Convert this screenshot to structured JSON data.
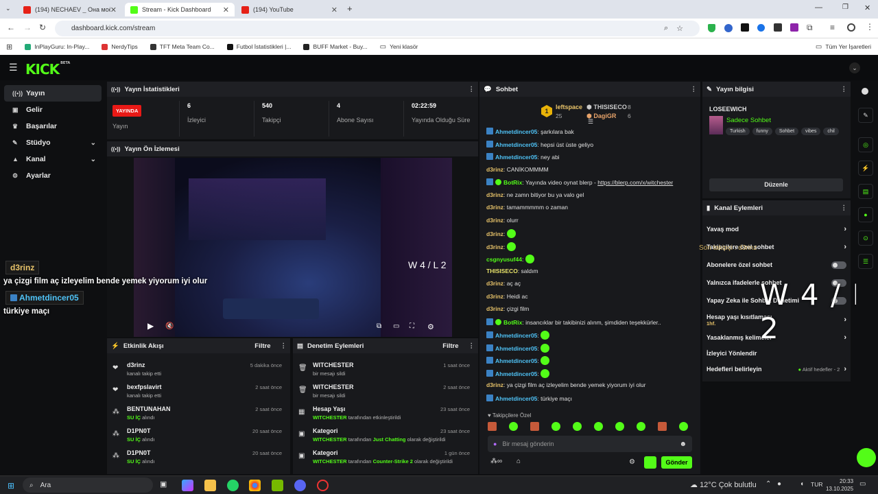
{
  "browser": {
    "tabs": [
      {
        "title": "(194) NECHAEV _ Она моё все..."
      },
      {
        "title": "Stream - Kick Dashboard"
      },
      {
        "title": "(194) YouTube"
      }
    ],
    "url": "dashboard.kick.com/stream",
    "bookmarks": [
      {
        "label": "InPlayGuru: In-Play..."
      },
      {
        "label": "NerdyTips"
      },
      {
        "label": "TFT Meta Team Co..."
      },
      {
        "label": "Futbol İstatistikleri |..."
      },
      {
        "label": "BUFF Market - Buy..."
      },
      {
        "label": "Yeni klasör"
      }
    ],
    "all_bookmarks": "Tüm Yer İşaretleri"
  },
  "header": {
    "logo": "KICK",
    "logo_badge": "BETA"
  },
  "sidebar": {
    "items": [
      {
        "label": "Yayın",
        "icon": "broadcast-icon"
      },
      {
        "label": "Gelir",
        "icon": "wallet-icon"
      },
      {
        "label": "Başarılar",
        "icon": "trophy-icon"
      },
      {
        "label": "Stüdyo",
        "icon": "wrench-icon"
      },
      {
        "label": "Kanal",
        "icon": "person-icon"
      },
      {
        "label": "Ayarlar",
        "icon": "gear-icon"
      }
    ]
  },
  "stream_stats": {
    "title": "Yayın İstatistikleri",
    "live_badge": "YAYINDA",
    "live_label": "Yayın",
    "viewers": {
      "value": "6",
      "label": "İzleyici"
    },
    "followers": {
      "value": "540",
      "label": "Takipçi"
    },
    "subs": {
      "value": "4",
      "label": "Abone Sayısı"
    },
    "uptime": {
      "value": "02:22:59",
      "label": "Yayında Olduğu Süre"
    }
  },
  "preview": {
    "title": "Yayın Ön İzlemesi",
    "score": "W 4 / L 2",
    "follower_ticker": "Son takipçi : d3rinz"
  },
  "overlay": {
    "name1": "d3rinz",
    "msg1": "ya çizgi film aç izleyelim bende yemek yiyorum iyi olur",
    "name2": "Ahmetdincer05",
    "msg2": "türkiye maçı",
    "big_score": "W 4 / L 2"
  },
  "activity": {
    "title": "Etkinlik Akışı",
    "filter": "Filtre",
    "items": [
      {
        "name": "d3rinz",
        "sub": "kanalı takip etti",
        "time": "5 dakika önce",
        "icon": "heart-icon"
      },
      {
        "name": "bexfpslavirt",
        "sub": "kanalı takip etti",
        "time": "2 saat önce",
        "icon": "heart-icon"
      },
      {
        "name": "BENTUNAHAN",
        "sub_hl": "SU İÇ",
        "sub": "alındı",
        "time": "2 saat önce",
        "icon": "points-icon"
      },
      {
        "name": "D1PN0T",
        "sub_hl": "SU İÇ",
        "sub": "alındı",
        "time": "20 saat önce",
        "icon": "points-icon"
      },
      {
        "name": "D1PN0T",
        "sub_hl": "SU İÇ",
        "sub": "alındı",
        "time": "20 saat önce",
        "icon": "points-icon"
      }
    ]
  },
  "moderation": {
    "title": "Denetim Eylemleri",
    "filter": "Filtre",
    "items": [
      {
        "name": "WITCHESTER",
        "sub": "bir mesajı sildi",
        "time": "1 saat önce",
        "icon": "trash-icon"
      },
      {
        "name": "WITCHESTER",
        "sub": "bir mesajı sildi",
        "time": "2 saat önce",
        "icon": "trash-icon"
      },
      {
        "name": "Hesap Yaşı",
        "sub_hl": "WITCHESTER",
        "sub": "tarafından etkinleştirildi",
        "time": "23 saat önce",
        "icon": "calendar-icon"
      },
      {
        "name": "Kategori",
        "sub_hl": "WITCHESTER",
        "sub": "tarafından",
        "sub_hl2": "Just Chatting",
        "sub2": "olarak değiştirildi",
        "time": "23 saat önce",
        "icon": "category-icon"
      },
      {
        "name": "Kategori",
        "sub_hl": "WITCHESTER",
        "sub": "tarafından",
        "sub_hl2": "Counter-Strike 2",
        "sub2": "olarak değiştirildi",
        "time": "1 gün önce",
        "icon": "category-icon"
      }
    ]
  },
  "chat": {
    "title": "Sohbet",
    "leaders": [
      {
        "rank": "1",
        "name": "leftspace",
        "count": "25"
      },
      {
        "name": "THISISECO",
        "count": "8"
      },
      {
        "name": "DagiGR",
        "count": "6"
      }
    ],
    "messages": [
      {
        "user": "Ahmetdincer05",
        "color": "#4fc3f7",
        "badge": true,
        "text": ": şarkılara bak"
      },
      {
        "user": "Ahmetdincer05",
        "color": "#4fc3f7",
        "badge": true,
        "text": ": hepsi üst üste geliyo"
      },
      {
        "user": "Ahmetdincer05",
        "color": "#4fc3f7",
        "badge": true,
        "text": ": ney abi"
      },
      {
        "user": "d3rinz",
        "color": "#e9c46a",
        "text": ": CANİKOMMMM"
      },
      {
        "user": "BotRix",
        "color": "#53fc18",
        "badge": true,
        "verified": true,
        "text": ": Yayında video oynat blerp - ",
        "link": "https://blerp.com/x/witchester"
      },
      {
        "user": "d3rinz",
        "color": "#e9c46a",
        "text": ": ne zamn bitiyor bu ya valo gel"
      },
      {
        "user": "d3rinz",
        "color": "#e9c46a",
        "text": ": tamammmmm o zaman"
      },
      {
        "user": "d3rinz",
        "color": "#e9c46a",
        "text": ": olurr"
      },
      {
        "user": "d3rinz",
        "color": "#e9c46a",
        "text": ": ",
        "emote": true
      },
      {
        "user": "d3rinz",
        "color": "#e9c46a",
        "text": ": ",
        "emote": true
      },
      {
        "user": "csgnyusuf44",
        "color": "#53fc18",
        "text": ": ",
        "emote": true
      },
      {
        "user": "THISISECO",
        "color": "#e9e46a",
        "text": ": saldım"
      },
      {
        "user": "d3rinz",
        "color": "#e9c46a",
        "text": ": aç aç"
      },
      {
        "user": "d3rinz",
        "color": "#e9c46a",
        "text": ": Heidi ac"
      },
      {
        "user": "d3rinz",
        "color": "#e9c46a",
        "text": ": çizgi film"
      },
      {
        "user": "BotRix",
        "color": "#53fc18",
        "badge": true,
        "verified": true,
        "text": ": insancıklar bir takibinizi alınm, şimdiden teşekkürler.."
      },
      {
        "user": "Ahmetdincer05",
        "color": "#4fc3f7",
        "badge": true,
        "text": ": ",
        "emote": true
      },
      {
        "user": "Ahmetdincer05",
        "color": "#4fc3f7",
        "badge": true,
        "text": ": ",
        "emote": true
      },
      {
        "user": "Ahmetdincer05",
        "color": "#4fc3f7",
        "badge": true,
        "text": ": ",
        "emote": true
      },
      {
        "user": "Ahmetdincer05",
        "color": "#4fc3f7",
        "badge": true,
        "text": ": ",
        "emote": true
      },
      {
        "user": "d3rinz",
        "color": "#e9c46a",
        "text": ": ya çizgi film aç izleyelim bende yemek yiyorum iyi olur"
      },
      {
        "user": "Ahmetdincer05",
        "color": "#4fc3f7",
        "badge": true,
        "text": ": türkiye maçı"
      }
    ],
    "follower_only_label": "Takipçilere Özel",
    "input_placeholder": "Bir mesaj gönderin",
    "send": "Gönder"
  },
  "stream_info": {
    "title": "Yayın bilgisi",
    "channel": "LOSEEWICH",
    "category": "Sadece Sohbet",
    "tags": [
      "Turkish",
      "funny",
      "Sohbet",
      "vibes",
      "chil"
    ],
    "edit": "Düzenle"
  },
  "channel_actions": {
    "title": "Kanal Eylemleri",
    "items": [
      {
        "label": "Yavaş mod",
        "type": "arrow"
      },
      {
        "label": "Takipçilere özel sohbet",
        "type": "arrow"
      },
      {
        "label": "Abonelere özel sohbet",
        "type": "toggle"
      },
      {
        "label": "Yalnızca ifadelerle sohbet",
        "type": "toggle"
      },
      {
        "label": "Yapay Zeka ile Sohbet Denetimi",
        "type": "toggle"
      },
      {
        "label": "Hesap yaşı kısıtlaması",
        "sub": "1hf.",
        "type": "arrow"
      },
      {
        "label": "Yasaklanmış kelimeler",
        "type": "arrow"
      },
      {
        "label": "İzleyici Yönlendir",
        "type": "none"
      },
      {
        "label": "Hedefleri belirleyin",
        "status": "Aktif hedefler - 2",
        "type": "arrow"
      }
    ]
  },
  "taskbar": {
    "search": "Ara",
    "weather": "12°C  Çok bulutlu",
    "lang": "TUR",
    "time": "20:33",
    "date": "13.10.2025"
  },
  "colors": {
    "accent": "#53fc18",
    "live": "#e91916",
    "panel": "#18191c",
    "bg": "#0e0f11"
  }
}
